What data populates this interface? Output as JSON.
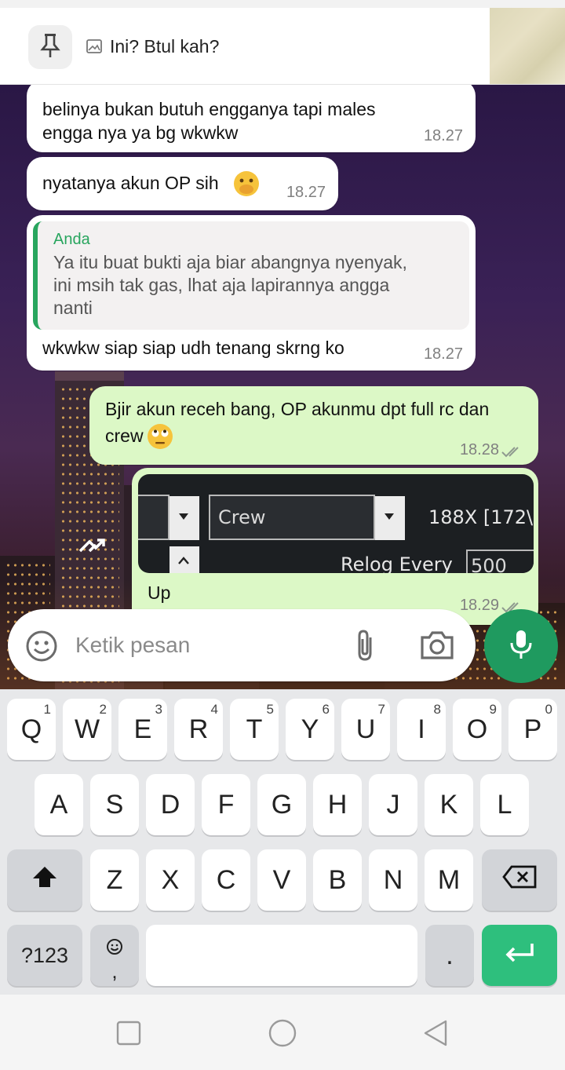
{
  "pinned": {
    "text": "Ini? Btul kah?",
    "pin_icon": "pin-icon",
    "media_icon": "image-icon"
  },
  "messages": [
    {
      "text_l1": "belinya bukan butuh engganya tapi males",
      "text_l2": "engga nya ya bg wkwkw",
      "time": "18.27",
      "direction": "in"
    },
    {
      "text": "nyatanya akun OP sih",
      "emoji": "hand-over-mouth-emoji",
      "time": "18.27",
      "direction": "in"
    },
    {
      "quote_author": "Anda",
      "quote_l1": "Ya itu buat bukti aja biar abangnya nyenyak,",
      "quote_l2": "ini msih tak gas, lhat aja lapirannya angga",
      "quote_l3": "nanti",
      "text": "wkwkw siap siap udh tenang skrng ko",
      "time": "18.27",
      "direction": "in"
    },
    {
      "text_l1": "Bjir akun receh bang, OP akunmu dpt full rc dan",
      "text_l2": "crew",
      "emoji": "eye-roll-emoji",
      "time": "18.28",
      "status": "read",
      "direction": "out"
    },
    {
      "caption": "Up",
      "time": "18.29",
      "status": "read",
      "direction": "out",
      "media": {
        "dropdown_value": "Crew",
        "label_right": "188X [172\\",
        "relog_label": "Relog Every",
        "relog_value": "500"
      }
    }
  ],
  "composer": {
    "placeholder": "Ketik pesan",
    "icons": [
      "emoji-icon",
      "attach-icon",
      "camera-icon",
      "mic-icon"
    ]
  },
  "keyboard": {
    "row1": [
      {
        "k": "Q",
        "s": "1"
      },
      {
        "k": "W",
        "s": "2"
      },
      {
        "k": "E",
        "s": "3"
      },
      {
        "k": "R",
        "s": "4"
      },
      {
        "k": "T",
        "s": "5"
      },
      {
        "k": "Y",
        "s": "6"
      },
      {
        "k": "U",
        "s": "7"
      },
      {
        "k": "I",
        "s": "8"
      },
      {
        "k": "O",
        "s": "9"
      },
      {
        "k": "P",
        "s": "0"
      }
    ],
    "row2": [
      "A",
      "S",
      "D",
      "F",
      "G",
      "H",
      "J",
      "K",
      "L"
    ],
    "row3": [
      "Z",
      "X",
      "C",
      "V",
      "B",
      "N",
      "M"
    ],
    "sym": "?123",
    "comma": ",",
    "period": "."
  },
  "colors": {
    "accent": "#1f9a5f",
    "outgoing_bubble": "#dcf8c6",
    "quote_bar": "#28a55e",
    "enter_key": "#2ebf7d"
  }
}
